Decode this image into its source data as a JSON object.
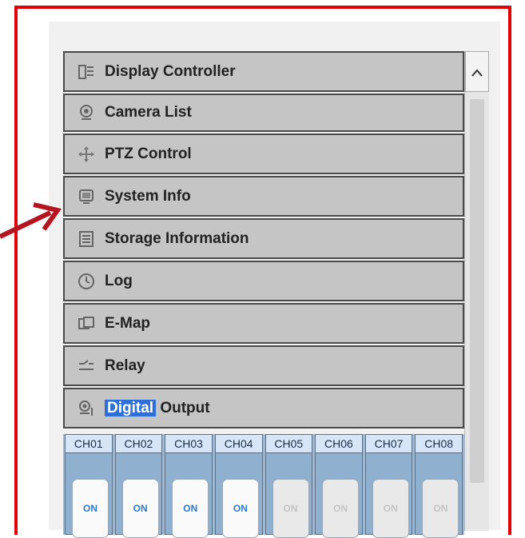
{
  "menu": {
    "items": [
      {
        "label": "Display Controller",
        "icon": "display-controller-icon"
      },
      {
        "label": "Camera List",
        "icon": "webcam-icon"
      },
      {
        "label": "PTZ Control",
        "icon": "ptz-arrows-icon"
      },
      {
        "label": "System Info",
        "icon": "monitor-icon"
      },
      {
        "label": "Storage Information",
        "icon": "storage-icon"
      },
      {
        "label": "Log",
        "icon": "clock-icon"
      },
      {
        "label": "E-Map",
        "icon": "map-icon"
      },
      {
        "label": "Relay",
        "icon": "relay-icon"
      },
      {
        "label_highlight": "Digital",
        "label_rest": " Output",
        "icon": "digital-output-icon"
      }
    ]
  },
  "channels": [
    {
      "name": "CH01",
      "state": "ON",
      "on": true
    },
    {
      "name": "CH02",
      "state": "ON",
      "on": true
    },
    {
      "name": "CH03",
      "state": "ON",
      "on": true
    },
    {
      "name": "CH04",
      "state": "ON",
      "on": true
    },
    {
      "name": "CH05",
      "state": "ON",
      "on": false
    },
    {
      "name": "CH06",
      "state": "ON",
      "on": false
    },
    {
      "name": "CH07",
      "state": "ON",
      "on": false
    },
    {
      "name": "CH08",
      "state": "ON",
      "on": false
    }
  ],
  "scrollbar": {
    "up_icon": "chevron-up-icon"
  },
  "colors": {
    "frame": "#e30000",
    "arrow": "#b4151e",
    "highlight": "#2f6fd8",
    "switch_on_text": "#2d78c8"
  }
}
